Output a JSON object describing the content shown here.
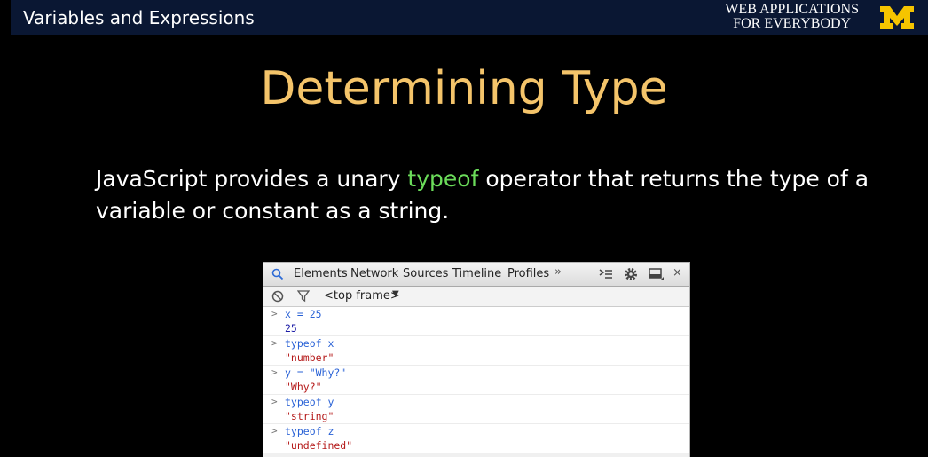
{
  "header": {
    "title": "Variables and Expressions",
    "brand_line1": "WEB APPLICATIONS",
    "brand_line2": "FOR EVERYBODY",
    "logo_icon": "block-m-logo",
    "logo_color": "#f5c400"
  },
  "slide": {
    "title": "Determining Type",
    "text_before": "JavaScript provides a unary ",
    "keyword": "typeof",
    "text_after": " operator that returns the type of a variable or constant as a string."
  },
  "devtools": {
    "tabs": [
      "Elements",
      "Network",
      "Sources",
      "Timeline",
      "Profiles"
    ],
    "more_glyph": "»",
    "frame_selector": "<top frame>",
    "console_lines": [
      {
        "kind": "input",
        "text": "x = 25"
      },
      {
        "kind": "number",
        "text": "25"
      },
      {
        "kind": "input",
        "text": "typeof x"
      },
      {
        "kind": "string",
        "text": "\"number\""
      },
      {
        "kind": "input",
        "text": "y = \"Why?\""
      },
      {
        "kind": "string",
        "text": "\"Why?\""
      },
      {
        "kind": "input",
        "text": "typeof y"
      },
      {
        "kind": "string",
        "text": "\"string\""
      },
      {
        "kind": "input",
        "text": "typeof z"
      },
      {
        "kind": "string",
        "text": "\"undefined\""
      }
    ]
  }
}
